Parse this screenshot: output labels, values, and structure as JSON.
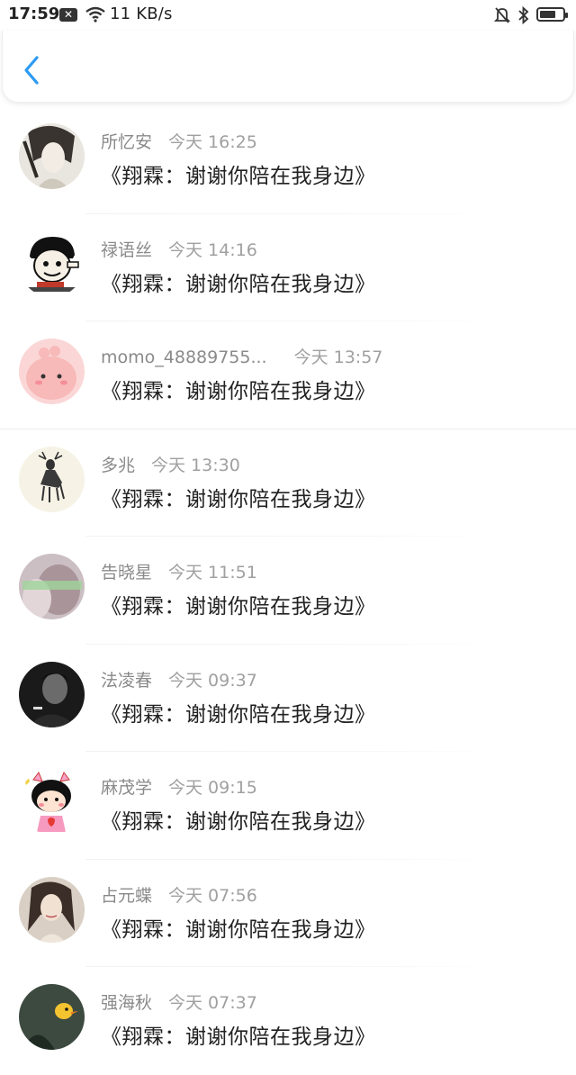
{
  "status_bar": {
    "time": "17:59",
    "speed": "11 KB/s"
  },
  "nav": {
    "back_icon": "chevron-left-icon",
    "accent": "#2b9af3"
  },
  "items": [
    {
      "name": "所忆安",
      "time": "今天 16:25",
      "message": "《翔霖：谢谢你陪在我身边》"
    },
    {
      "name": "禄语丝",
      "time": "今天 14:16",
      "message": "《翔霖：谢谢你陪在我身边》"
    },
    {
      "name": "momo_48889755...",
      "time": "今天 13:57",
      "message": "《翔霖：谢谢你陪在我身边》"
    },
    {
      "name": "多兆",
      "time": "今天 13:30",
      "message": "《翔霖：谢谢你陪在我身边》"
    },
    {
      "name": "告晓星",
      "time": "今天 11:51",
      "message": "《翔霖：谢谢你陪在我身边》"
    },
    {
      "name": "法凌春",
      "time": "今天 09:37",
      "message": "《翔霖：谢谢你陪在我身边》"
    },
    {
      "name": "麻茂学",
      "time": "今天 09:15",
      "message": "《翔霖：谢谢你陪在我身边》"
    },
    {
      "name": "占元蝶",
      "time": "今天 07:56",
      "message": "《翔霖：谢谢你陪在我身边》"
    },
    {
      "name": "强海秋",
      "time": "今天 07:37",
      "message": "《翔霖：谢谢你陪在我身边》"
    }
  ]
}
